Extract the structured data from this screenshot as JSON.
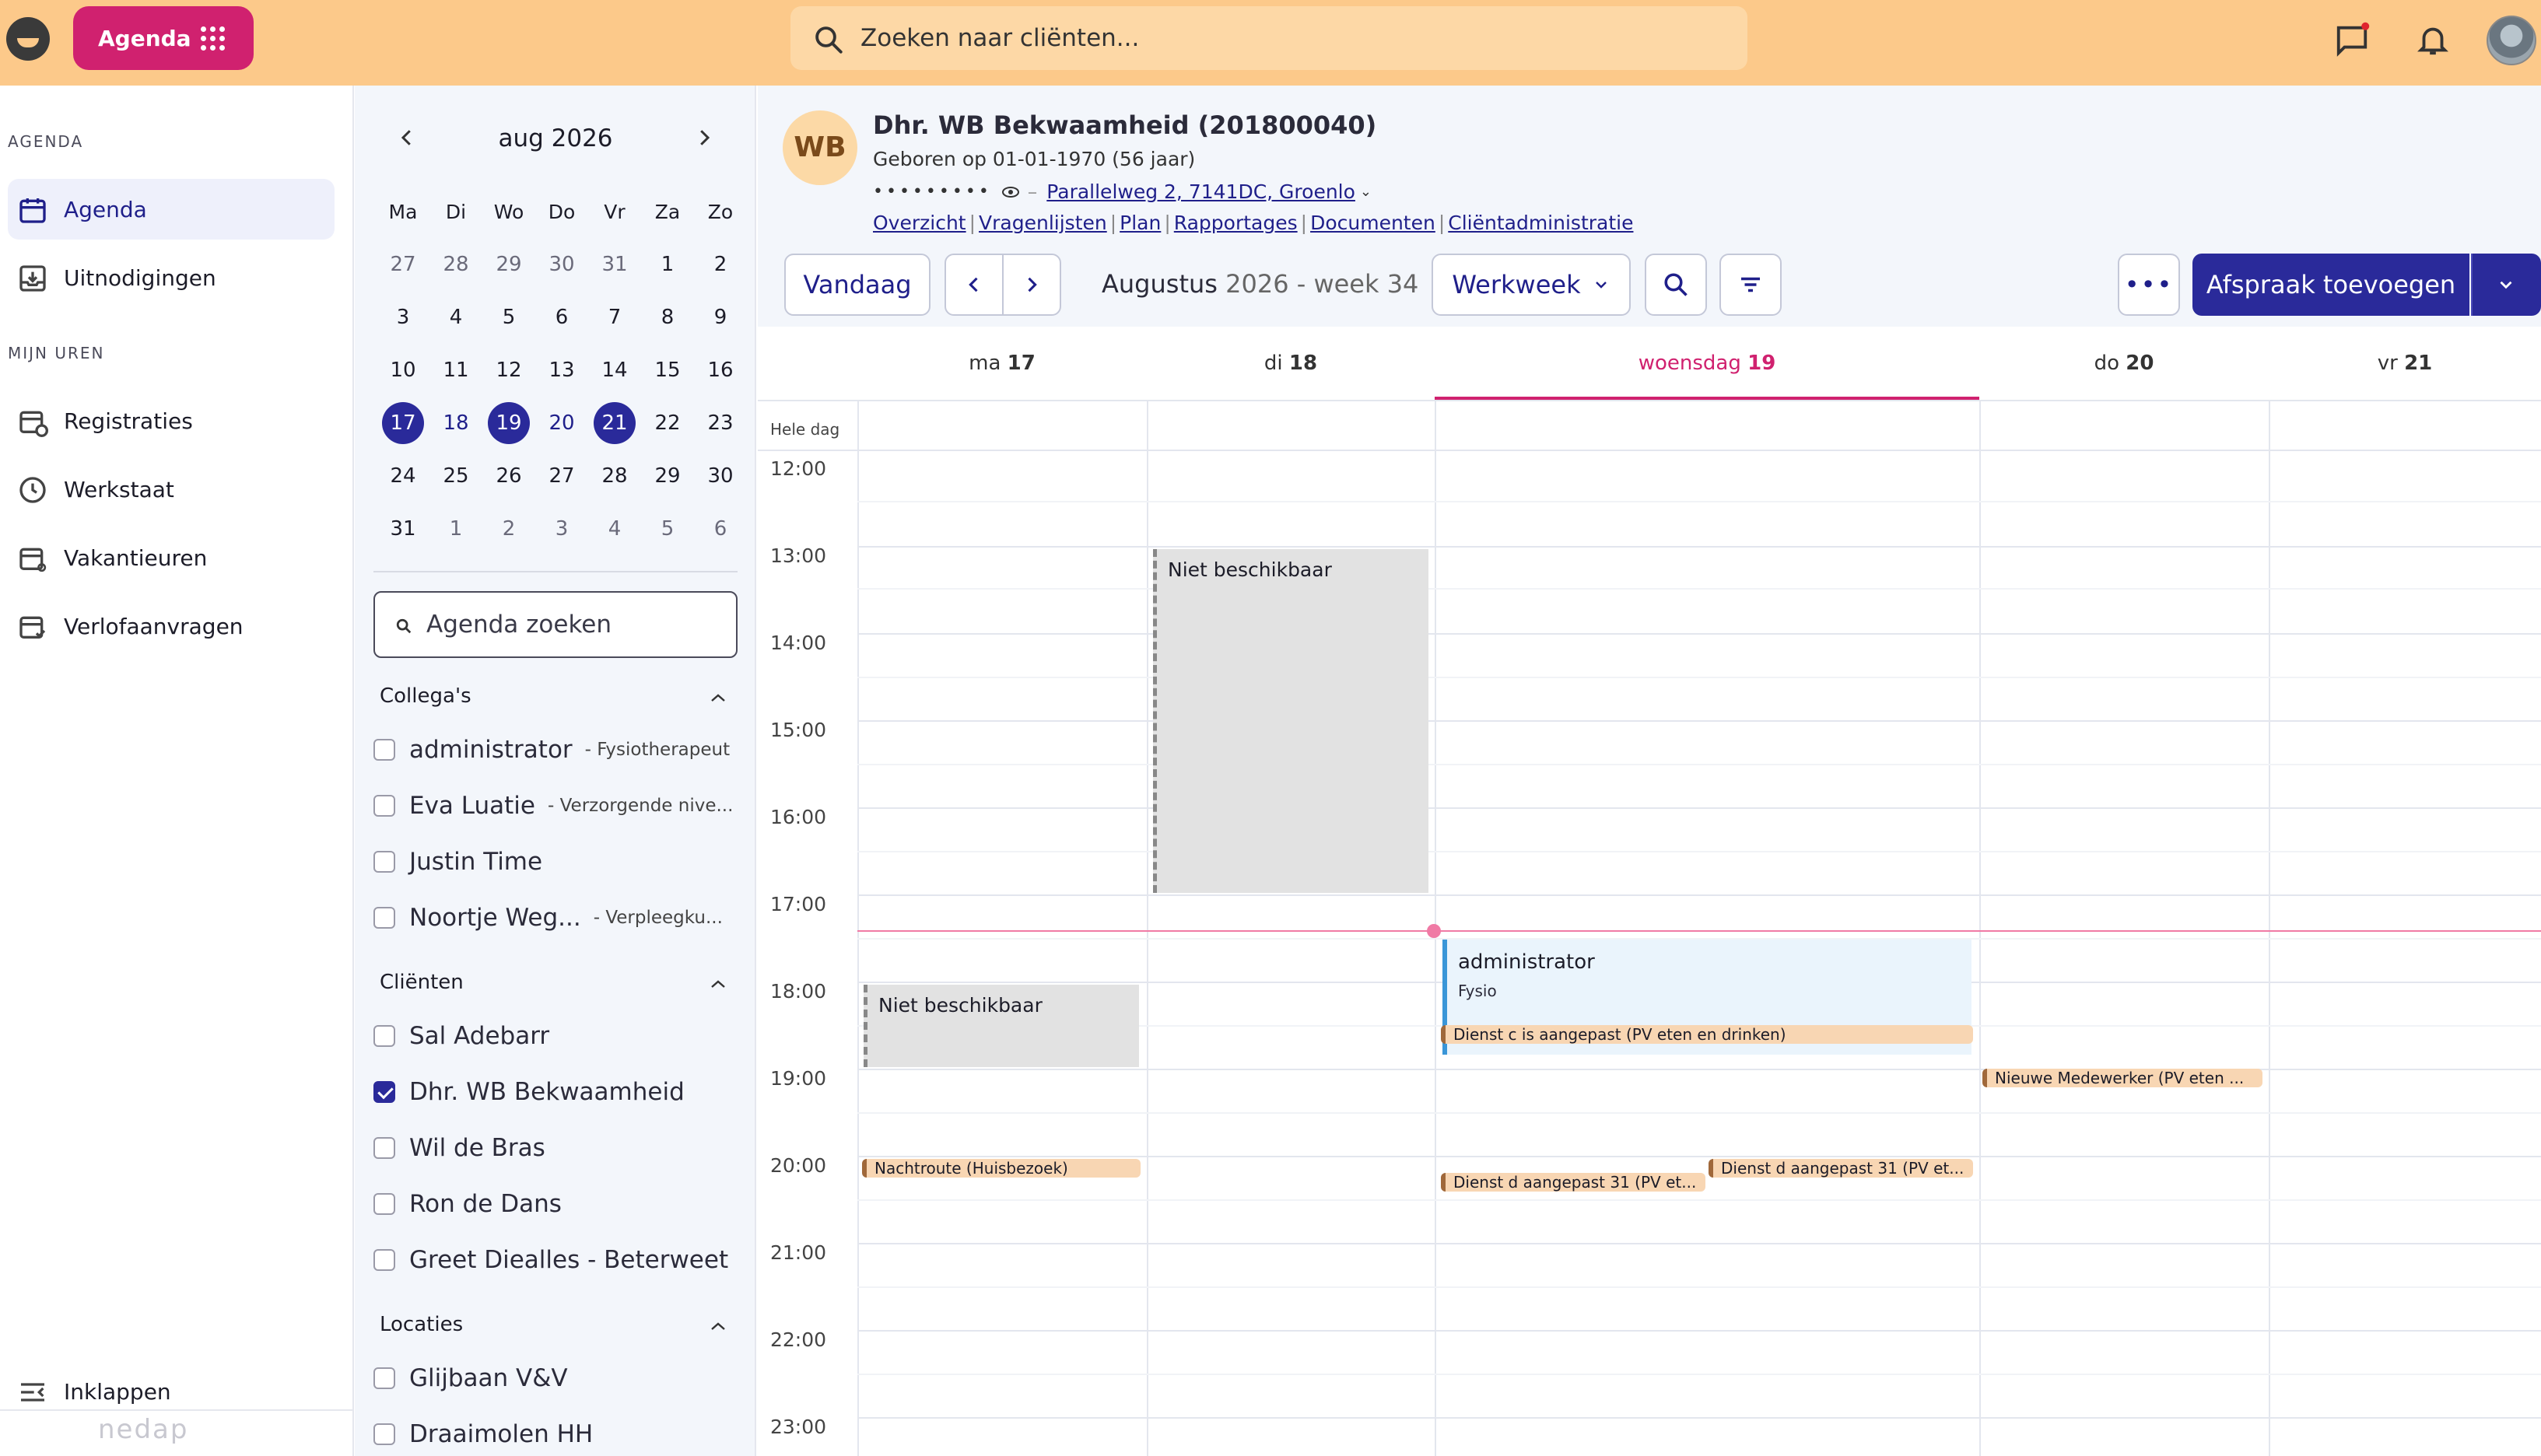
{
  "topbar": {
    "app_label": "Agenda",
    "search_placeholder": "Zoeken naar cliënten..."
  },
  "nav": {
    "section_agenda": "AGENDA",
    "item_agenda": "Agenda",
    "item_uitnodigingen": "Uitnodigingen",
    "section_uren": "MIJN UREN",
    "item_registraties": "Registraties",
    "item_werkstaat": "Werkstaat",
    "item_vakantieuren": "Vakantieuren",
    "item_verlof": "Verlofaanvragen",
    "collapse": "Inklappen",
    "brand": "nedap"
  },
  "mini_calendar": {
    "month_label": "aug 2026",
    "weekdays": [
      "Ma",
      "Di",
      "Wo",
      "Do",
      "Vr",
      "Za",
      "Zo"
    ],
    "weeks": [
      [
        "27",
        "28",
        "29",
        "30",
        "31",
        "1",
        "2"
      ],
      [
        "3",
        "4",
        "5",
        "6",
        "7",
        "8",
        "9"
      ],
      [
        "10",
        "11",
        "12",
        "13",
        "14",
        "15",
        "16"
      ],
      [
        "17",
        "18",
        "19",
        "20",
        "21",
        "22",
        "23"
      ],
      [
        "24",
        "25",
        "26",
        "27",
        "28",
        "29",
        "30"
      ],
      [
        "31",
        "1",
        "2",
        "3",
        "4",
        "5",
        "6"
      ]
    ]
  },
  "filters": {
    "search_placeholder": "Agenda zoeken",
    "colleagues_title": "Collega's",
    "colleagues": [
      {
        "name": "administrator",
        "role": "- Fysiotherapeut"
      },
      {
        "name": "Eva Luatie",
        "role": "- Verzorgende nive..."
      },
      {
        "name": "Justin Time",
        "role": ""
      },
      {
        "name": "Noortje Weg...",
        "role": "- Verpleegku..."
      }
    ],
    "clients_title": "Cliënten",
    "clients": [
      {
        "name": "Sal Adebarr",
        "checked": false
      },
      {
        "name": "Dhr. WB Bekwaamheid",
        "checked": true
      },
      {
        "name": "Wil de Bras",
        "checked": false
      },
      {
        "name": "Ron de Dans",
        "checked": false
      },
      {
        "name": "Greet Diealles - Beterweet",
        "checked": false
      }
    ],
    "locations_title": "Locaties",
    "locations": [
      "Glijbaan V&V",
      "Draaimolen HH"
    ]
  },
  "client": {
    "initials": "WB",
    "name": "Dhr. WB Bekwaamheid (201800040)",
    "born": "Geboren op 01-01-1970 (56 jaar)",
    "masked": "•••••••••",
    "address": "Parallelweg 2, 7141DC, Groenlo",
    "links": [
      "Overzicht",
      "Vragenlijsten",
      "Plan",
      "Rapportages",
      "Documenten",
      "Cliëntadministratie"
    ]
  },
  "toolbar": {
    "today": "Vandaag",
    "week_month": "Augustus",
    "week_rest": "2026 - week 34",
    "view": "Werkweek",
    "add": "Afspraak toevoegen"
  },
  "days": [
    {
      "name": "ma",
      "num": "17"
    },
    {
      "name": "di",
      "num": "18"
    },
    {
      "name": "woensdag",
      "num": "19"
    },
    {
      "name": "do",
      "num": "20"
    },
    {
      "name": "vr",
      "num": "21"
    }
  ],
  "allday_label": "Hele dag",
  "hours": [
    "12:00",
    "13:00",
    "14:00",
    "15:00",
    "16:00",
    "17:00",
    "18:00",
    "19:00",
    "20:00",
    "21:00",
    "22:00",
    "23:00"
  ],
  "events": {
    "unavailable": "Niet beschikbaar",
    "admin_title": "administrator",
    "admin_sub": "Fysio",
    "dienst_c": "Dienst c is aangepast (PV eten en drinken)",
    "nieuwe": "Nieuwe Medewerker (PV eten ...",
    "nachtroute": "Nachtroute (Huisbezoek)",
    "dienst_d1": "Dienst d aangepast 31 (PV et...",
    "dienst_d2": "Dienst d aangepast 31 (PV et..."
  },
  "colors": {
    "topbar": "#fcc98a",
    "accent_pink": "#d0216f",
    "primary": "#2a2a9a"
  }
}
